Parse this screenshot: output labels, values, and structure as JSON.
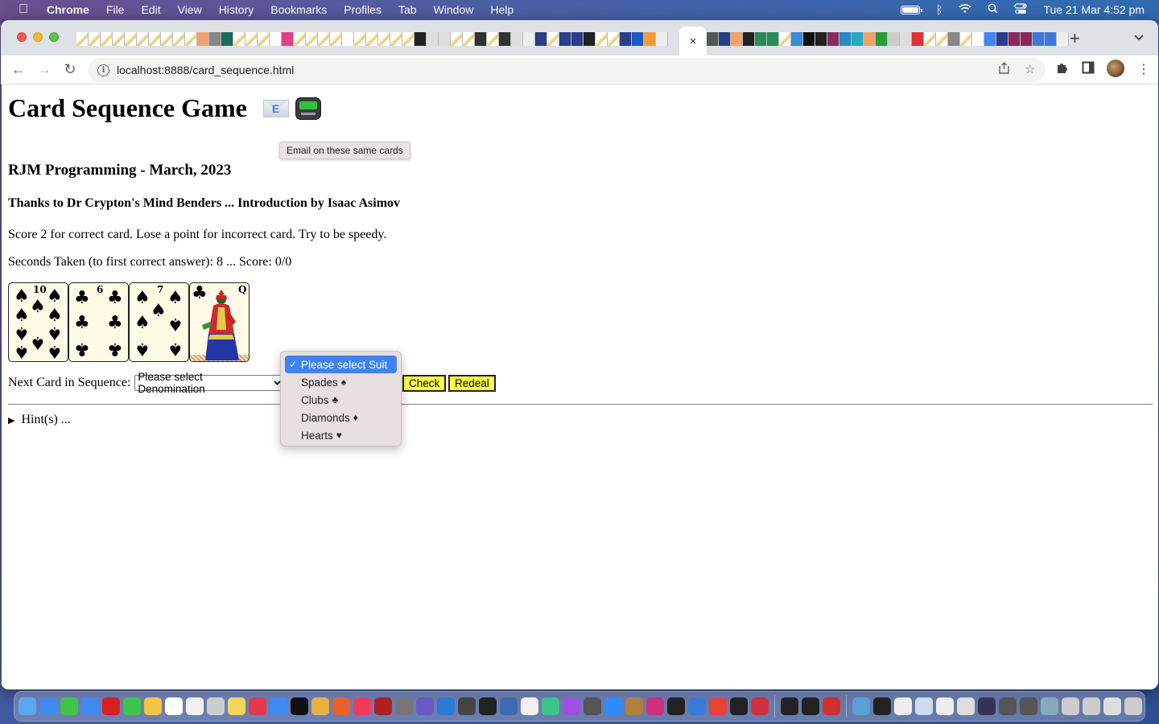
{
  "menubar": {
    "app_name": "Chrome",
    "items": [
      "File",
      "Edit",
      "View",
      "History",
      "Bookmarks",
      "Profiles",
      "Tab",
      "Window",
      "Help"
    ],
    "status_icons": [
      "battery-icon",
      "bluetooth-icon",
      "wifi-icon",
      "spotlight-search-icon",
      "control-center-icon"
    ],
    "clock": "Tue 21 Mar  4:52 pm"
  },
  "browser": {
    "active_tab_close_glyph": "×",
    "new_tab_glyph": "+",
    "tab_menu_glyph": "⌄",
    "url_host": "localhost",
    "url_rest": ":8888/card_sequence.html"
  },
  "page": {
    "title": "Card Sequence Game",
    "email_icon_letter": "E",
    "tooltip": "Email on these same cards",
    "subtitle": "RJM Programming - March, 2023",
    "thanks": "Thanks to Dr Crypton's Mind Benders ... Introduction by Isaac Asimov",
    "rules": "Score 2 for correct card. Lose a point for incorrect card. Try to be speedy.",
    "status": "Seconds Taken (to first correct answer): 8 ... Score: 0/0",
    "cards": [
      {
        "rank": "10",
        "suit": "Spades",
        "glyph": "♠"
      },
      {
        "rank": "6",
        "suit": "Clubs",
        "glyph": "♣"
      },
      {
        "rank": "7",
        "suit": "Spades",
        "glyph": "♠"
      },
      {
        "rank": "Q",
        "suit": "Clubs",
        "glyph": "♣"
      }
    ],
    "next_card_label": "Next Card in Sequence:",
    "denomination_select": {
      "selected": "Please select Denomination"
    },
    "suit_select": {
      "selected": "Please select Suit",
      "options": [
        {
          "label": "Please select Suit",
          "suit_glyph": "",
          "selected": true
        },
        {
          "label": "Spades",
          "suit_glyph": "♠",
          "selected": false
        },
        {
          "label": "Clubs",
          "suit_glyph": "♣",
          "selected": false
        },
        {
          "label": "Diamonds",
          "suit_glyph": "♦",
          "selected": false
        },
        {
          "label": "Hearts",
          "suit_glyph": "♥",
          "selected": false
        }
      ]
    },
    "check_button": "Check",
    "redeal_button": "Redeal",
    "hints_summary": "Hint(s) ...",
    "button_color": "#ffff44"
  }
}
